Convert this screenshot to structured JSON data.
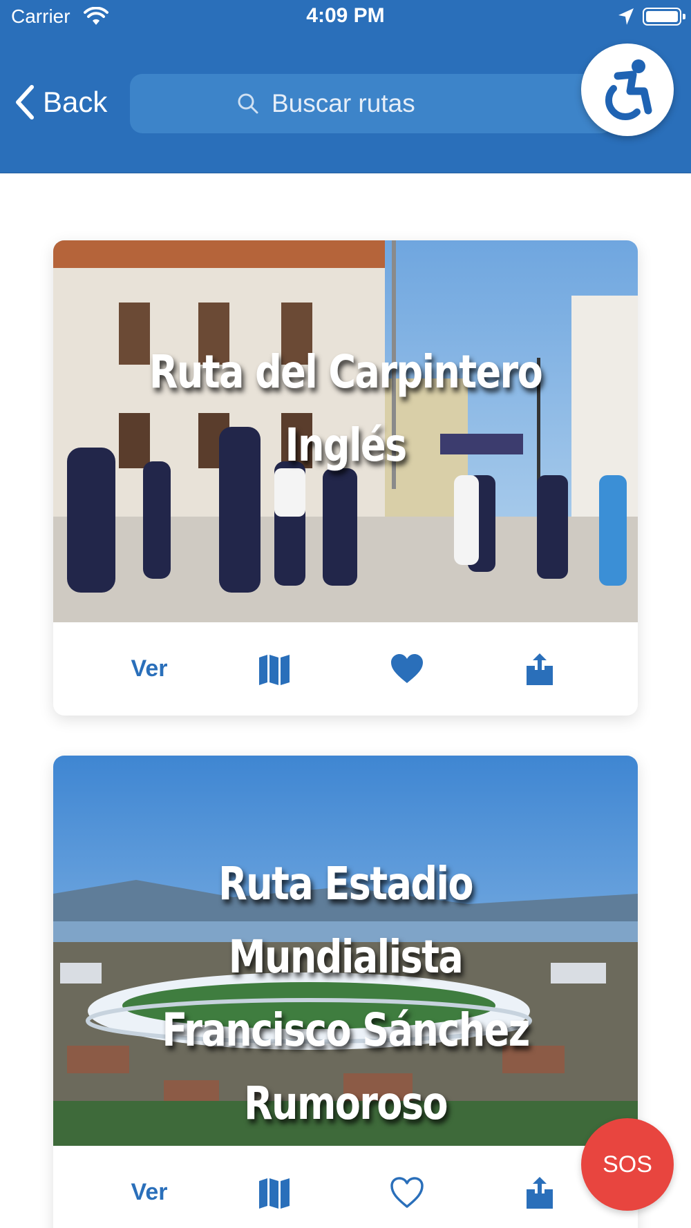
{
  "status_bar": {
    "carrier": "Carrier",
    "time": "4:09 PM",
    "wifi_icon": "wifi-icon",
    "location_icon": "location-arrow-icon",
    "battery_icon": "battery-icon"
  },
  "nav": {
    "back_label": "Back",
    "search_placeholder": "Buscar rutas",
    "accessibility_icon": "wheelchair-icon"
  },
  "routes": [
    {
      "title": "Ruta del Carpintero Inglés",
      "view_label": "Ver",
      "map_icon": "map-icon",
      "favorite_icon": "heart-filled-icon",
      "favorited": true,
      "share_icon": "share-icon"
    },
    {
      "title_line1": "Ruta Estadio Mundialista",
      "title_line2": "Francisco Sánchez Rumoroso",
      "view_label": "Ver",
      "map_icon": "map-icon",
      "favorite_icon": "heart-outline-icon",
      "favorited": false,
      "share_icon": "share-icon"
    }
  ],
  "sos_label": "SOS",
  "colors": {
    "primary": "#2a6fba",
    "search_bg": "#3d84c9",
    "sos": "#e8453f",
    "background": "#ffffff"
  }
}
